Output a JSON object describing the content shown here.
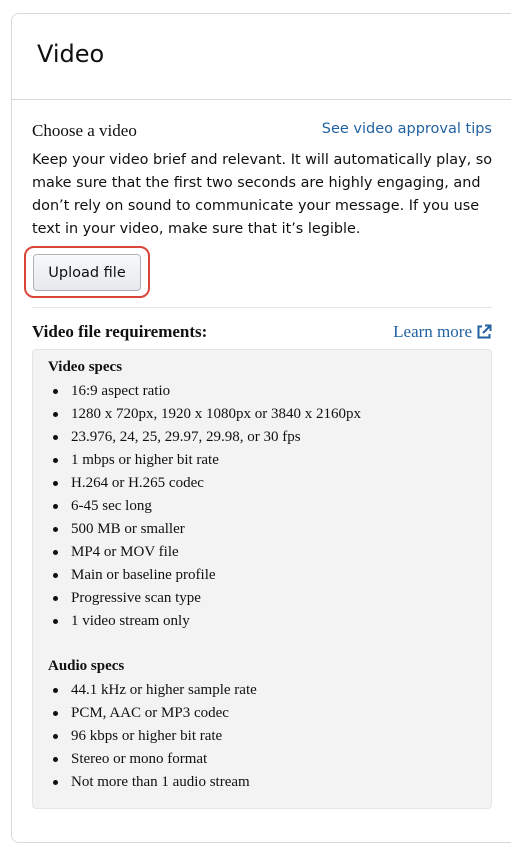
{
  "card": {
    "title": "Video"
  },
  "choose": {
    "label": "Choose a video",
    "tips_link": "See video approval tips",
    "description": "Keep your video brief and relevant. It will automatically play, so make sure that the first two seconds are highly engaging, and don’t rely on sound to communicate your message. If you use text in your video, make sure that it’s legible.",
    "upload_button": "Upload file",
    "highlight_color": "#d8463a"
  },
  "requirements": {
    "title": "Video file requirements:",
    "learn_more": "Learn more",
    "learn_more_icon": "external-link-icon",
    "video_specs": {
      "heading": "Video specs",
      "items": [
        "16:9 aspect ratio",
        "1280 x 720px, 1920 x 1080px or 3840 x 2160px",
        "23.976, 24, 25, 29.97, 29.98, or 30 fps",
        "1 mbps or higher bit rate",
        "H.264 or H.265 codec",
        "6-45 sec long",
        "500 MB or smaller",
        "MP4 or MOV file",
        "Main or baseline profile",
        "Progressive scan type",
        "1 video stream only"
      ]
    },
    "audio_specs": {
      "heading": "Audio specs",
      "items": [
        "44.1 kHz or higher sample rate",
        "PCM, AAC or MP3 codec",
        "96 kbps or higher bit rate",
        "Stereo or mono format",
        "Not more than 1 audio stream"
      ]
    }
  },
  "colors": {
    "link": "#2162a1",
    "text": "#0f1111",
    "spec_bg": "#f3f3f3"
  }
}
